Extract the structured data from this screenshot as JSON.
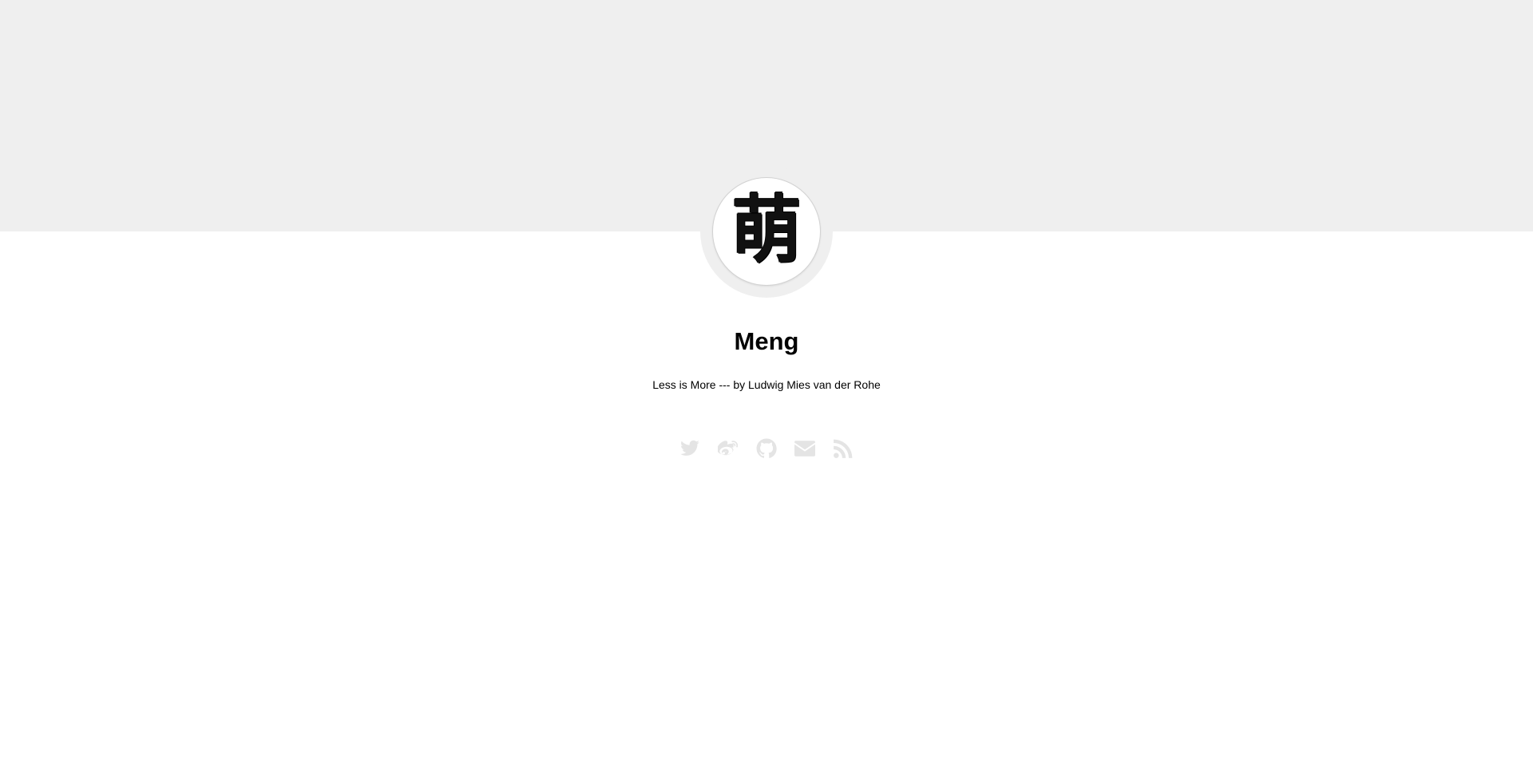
{
  "profile": {
    "avatar_glyph": "萌",
    "name": "Meng",
    "bio": "Less is More --- by Ludwig Mies van der Rohe"
  },
  "social_links": [
    {
      "icon": "twitter-icon"
    },
    {
      "icon": "weibo-icon"
    },
    {
      "icon": "github-icon"
    },
    {
      "icon": "email-icon"
    },
    {
      "icon": "rss-icon"
    }
  ],
  "colors": {
    "banner": "#efefef",
    "background": "#ffffff",
    "icon": "#e4e4e4",
    "text": "#000000"
  }
}
